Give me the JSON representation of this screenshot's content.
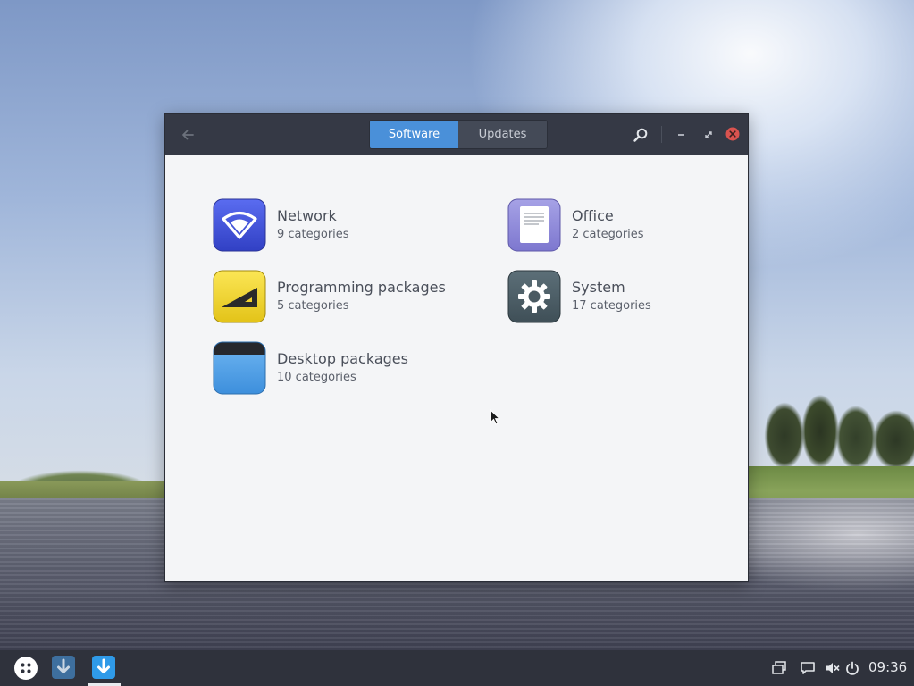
{
  "window": {
    "tabs": [
      {
        "label": "Software",
        "active": true
      },
      {
        "label": "Updates",
        "active": false
      }
    ]
  },
  "categories": [
    {
      "name": "Network",
      "count": "9 categories",
      "icon": "network-wifi-icon"
    },
    {
      "name": "Office",
      "count": "2 categories",
      "icon": "office-document-icon"
    },
    {
      "name": "Programming packages",
      "count": "5 categories",
      "icon": "programming-ruler-icon"
    },
    {
      "name": "System",
      "count": "17 categories",
      "icon": "system-gear-icon"
    },
    {
      "name": "Desktop packages",
      "count": "10 categories",
      "icon": "desktop-window-icon"
    }
  ],
  "taskbar": {
    "clock": "09:36",
    "apps": [
      "app-launcher-icon",
      "software-installer-icon",
      "software-center-icon"
    ],
    "tray": [
      "windows-icon",
      "chat-icon",
      "volume-muted-icon",
      "power-icon"
    ]
  },
  "colors": {
    "accent": "#4a90d9",
    "titlebar": "#353945",
    "close": "#d9534f"
  }
}
